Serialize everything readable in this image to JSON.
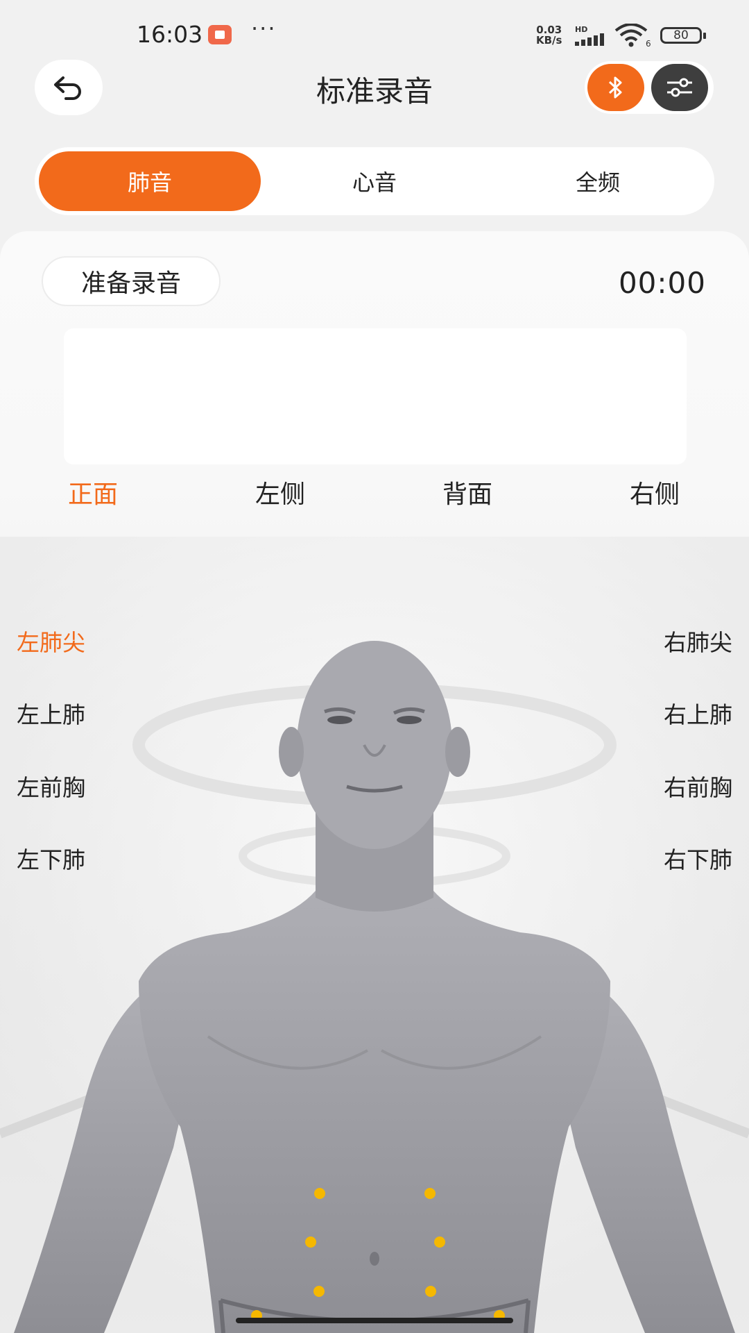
{
  "status_bar": {
    "time": "16:03",
    "speed_value": "0.03",
    "speed_unit": "KB/s",
    "network": "HD",
    "wifi_level": "6",
    "battery": "80"
  },
  "header": {
    "title": "标准录音",
    "accent_color": "#f26a1b"
  },
  "mode_tabs": [
    {
      "label": "肺音",
      "active": true
    },
    {
      "label": "心音",
      "active": false
    },
    {
      "label": "全频",
      "active": false
    }
  ],
  "recording": {
    "ready_label": "准备录音",
    "timer": "00:00"
  },
  "view_tabs": [
    {
      "label": "正面",
      "active": true
    },
    {
      "label": "左侧",
      "active": false
    },
    {
      "label": "背面",
      "active": false
    },
    {
      "label": "右侧",
      "active": false
    }
  ],
  "points_left": [
    {
      "label": "左肺尖",
      "active": true
    },
    {
      "label": "左上肺",
      "active": false
    },
    {
      "label": "左前胸",
      "active": false
    },
    {
      "label": "左下肺",
      "active": false
    }
  ],
  "points_right": [
    {
      "label": "右肺尖",
      "active": false
    },
    {
      "label": "右上肺",
      "active": false
    },
    {
      "label": "右前胸",
      "active": false
    },
    {
      "label": "右下肺",
      "active": false
    }
  ],
  "marker_color": "#f5b800"
}
